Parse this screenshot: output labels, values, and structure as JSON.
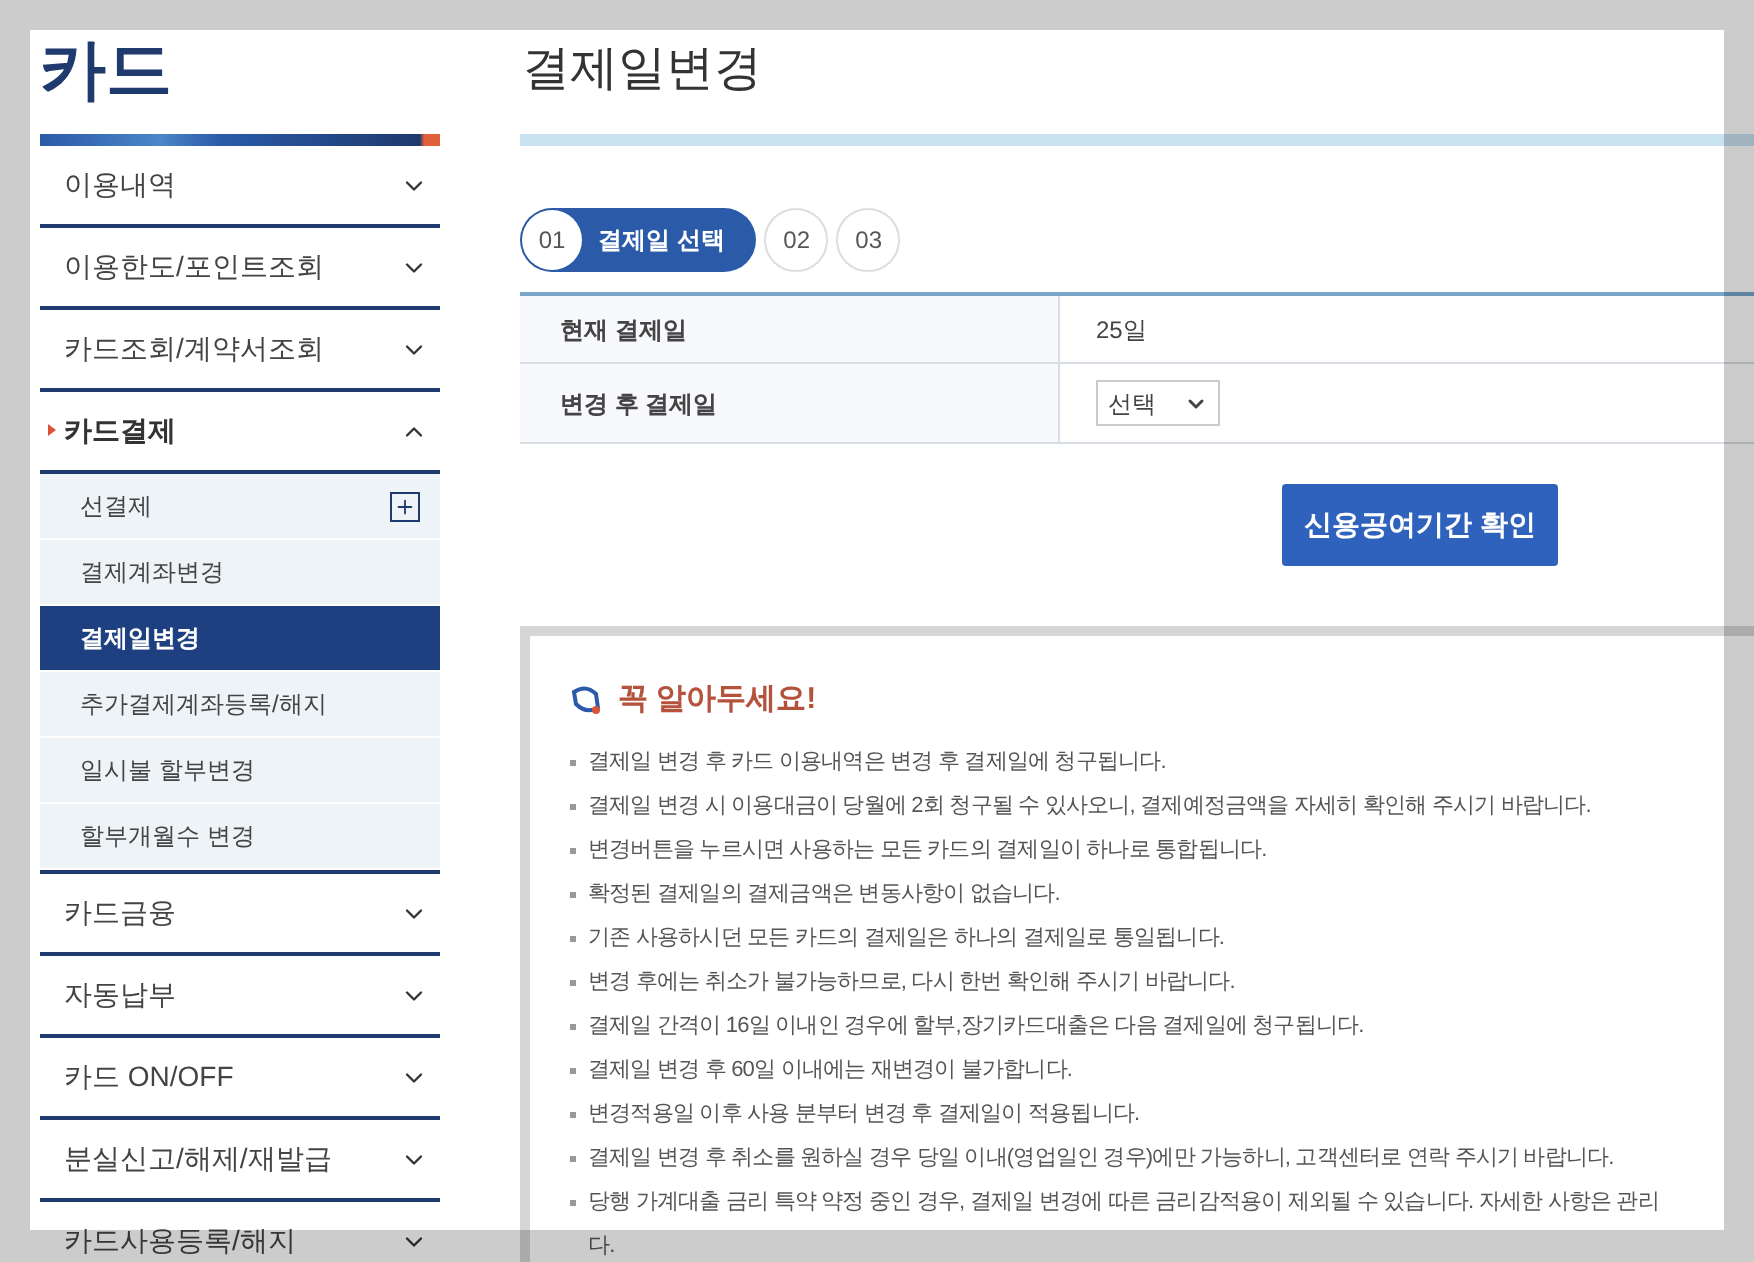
{
  "sidebar": {
    "title": "카드",
    "menu": [
      {
        "label": "이용내역",
        "selected": false,
        "expanded": false
      },
      {
        "label": "이용한도/포인트조회",
        "selected": false,
        "expanded": false
      },
      {
        "label": "카드조회/계약서조회",
        "selected": false,
        "expanded": false
      },
      {
        "label": "카드결제",
        "selected": true,
        "expanded": true,
        "children": [
          {
            "label": "선결제",
            "kind": "expandable",
            "selected": false
          },
          {
            "label": "결제계좌변경",
            "kind": "link",
            "selected": false
          },
          {
            "label": "결제일변경",
            "kind": "link",
            "selected": true
          },
          {
            "label": "추가결제계좌등록/해지",
            "kind": "link",
            "selected": false
          },
          {
            "label": "일시불 할부변경",
            "kind": "link",
            "selected": false
          },
          {
            "label": "할부개월수 변경",
            "kind": "link",
            "selected": false
          }
        ]
      },
      {
        "label": "카드금융",
        "selected": false,
        "expanded": false
      },
      {
        "label": "자동납부",
        "selected": false,
        "expanded": false
      },
      {
        "label": "카드 ON/OFF",
        "selected": false,
        "expanded": false
      },
      {
        "label": "분실신고/해제/재발급",
        "selected": false,
        "expanded": false
      },
      {
        "label": "카드사용등록/해지",
        "selected": false,
        "expanded": false
      }
    ]
  },
  "page_title": "결제일변경",
  "steps": [
    {
      "number": "01",
      "label": "결제일 선택",
      "selected": true
    },
    {
      "number": "02",
      "selected": false
    },
    {
      "number": "03",
      "selected": false
    }
  ],
  "form": [
    {
      "label": "현재 결제일",
      "kind": "text",
      "value": "25일"
    },
    {
      "label": "변경 후 결제일",
      "kind": "select",
      "value": "선택"
    }
  ],
  "confirm_button": "신용공여기간 확인",
  "notice": {
    "title": "꼭 알아두세요!",
    "items": [
      {
        "text": "결제일 변경 후 카드 이용내역은 변경 후 결제일에 청구됩니다."
      },
      {
        "text": "결제일 변경 시 이용대금이 당월에 2회 청구될 수 있사오니, 결제예정금액을 자세히 확인해 주시기 바랍니다."
      },
      {
        "text": "변경버튼을 누르시면 사용하는 모든 카드의 결제일이 하나로 통합됩니다."
      },
      {
        "text": "확정된 결제일의 결제금액은 변동사항이 없습니다."
      },
      {
        "text": "기존 사용하시던 모든 카드의 결제일은 하나의 결제일로 통일됩니다."
      },
      {
        "text": "변경 후에는 취소가 불가능하므로, 다시 한번 확인해 주시기 바랍니다."
      },
      {
        "text": "결제일 간격이 16일 이내인 경우에 할부,장기카드대출은 다음 결제일에 청구됩니다."
      },
      {
        "text": "결제일 변경 후 60일 이내에는 재변경이 불가합니다."
      },
      {
        "text": "변경적용일 이후 사용 분부터 변경 후 결제일이 적용됩니다."
      },
      {
        "text": "결제일 변경 후 취소를 원하실 경우 당일 이내(영업일인 경우)에만 가능하니, 고객센터로 연락 주시기 바랍니다."
      },
      {
        "text": "당행 가계대출 금리 특약 약정 중인 경우, 결제일 변경에 따른 금리감적용이 제외될 수 있습니다. 자세한 사항은 관리",
        "continuation": "다."
      }
    ]
  }
}
